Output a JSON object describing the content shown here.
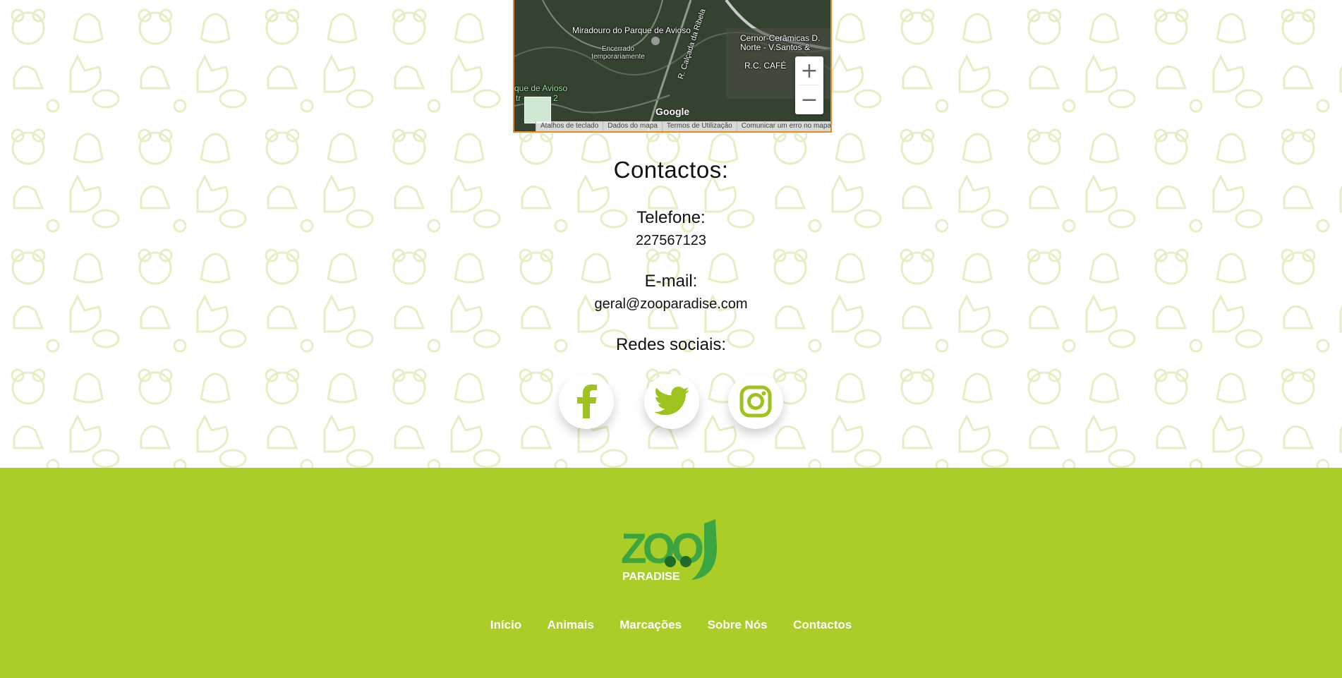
{
  "map": {
    "labels": {
      "miradouro": "Miradouro do Parque de Avioso",
      "encerrado": "Encerrado temporariamente",
      "rua": "R. Calçada da Ribela",
      "cernor": "Cernor-Cerâmicas D. Norte - V.Santos &",
      "rc_cafe": "R.C. CAFÉ",
      "parque": "que de Avioso",
      "parque_2": "tr",
      "num": "2"
    },
    "zoom_in": "+",
    "zoom_out": "−",
    "google": "Google",
    "footer": [
      "Atalhos de teclado",
      "Dados do mapa",
      "Termos de Utilização",
      "Comunicar um erro no mapa"
    ]
  },
  "contacts": {
    "title": "Contactos:",
    "phone_label": "Telefone:",
    "phone_value": "227567123",
    "email_label": "E-mail:",
    "email_value": "geral@zooparadise.com",
    "social_label": "Redes sociais:"
  },
  "social": {
    "icons": [
      "facebook-icon",
      "twitter-icon",
      "instagram-icon"
    ],
    "color": "#9ec31f"
  },
  "footer": {
    "logo_text": "ZOO",
    "logo_sub": "PARADISE",
    "nav": [
      "Início",
      "Animais",
      "Marcações",
      "Sobre Nós",
      "Contactos"
    ],
    "bg_color": "#aacd28"
  }
}
